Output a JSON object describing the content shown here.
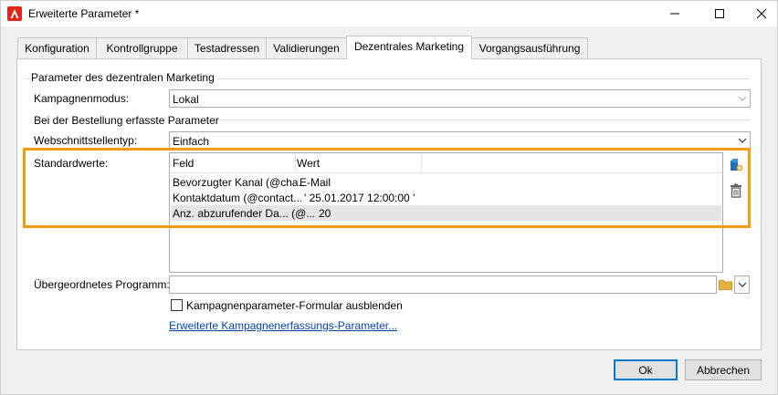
{
  "window": {
    "title": "Erweiterte Parameter *",
    "app_icon": "adobe-campaign-icon",
    "controls": [
      "minimize-icon",
      "maximize-icon",
      "close-icon"
    ]
  },
  "tabs": [
    {
      "label": "Konfiguration",
      "active": false
    },
    {
      "label": "Kontrollgruppe",
      "active": false
    },
    {
      "label": "Testadressen",
      "active": false
    },
    {
      "label": "Validierungen",
      "active": false
    },
    {
      "label": "Dezentrales Marketing",
      "active": true
    },
    {
      "label": "Vorgangsausführung",
      "active": false
    }
  ],
  "panel": {
    "group_title": "Parameter des dezentralen Marketing",
    "campaign_mode": {
      "label": "Kampagnenmodus:",
      "value": "Lokal",
      "disabled": true
    },
    "order_section_title": "Bei der Bestellung erfasste Parameter",
    "interface_type": {
      "label": "Webschnittstellentyp:",
      "value": "Einfach"
    },
    "defaults": {
      "label": "Standardwerte:",
      "columns": [
        "Feld",
        "Wert"
      ],
      "rows": [
        {
          "field": "Bevorzugter Kanal (@cha..",
          "value": "E-Mail",
          "selected": false
        },
        {
          "field": "Kontaktdatum (@contact...",
          "value": "' 25.01.2017  12:00:00 '",
          "selected": false
        },
        {
          "field": "Anz. abzurufender Da...  (@...",
          "value": "20",
          "selected": true
        }
      ],
      "side_icons": [
        "add-parameter-icon",
        "delete-icon"
      ]
    },
    "parent_program": {
      "label": "Übergeordnetes Programm:",
      "value": "",
      "icons": [
        "folder-icon",
        "chevron-down-icon"
      ]
    },
    "hide_form_checkbox": {
      "label": "Kampagnenparameter-Formular ausblenden",
      "checked": false
    },
    "advanced_link": "Erweiterte Kampagnenerfassungs-Parameter..."
  },
  "buttons": {
    "ok": "Ok",
    "cancel": "Abbrechen"
  },
  "colors": {
    "highlight": "#f39c12",
    "link": "#0645ad",
    "accent": "#0078d7"
  }
}
